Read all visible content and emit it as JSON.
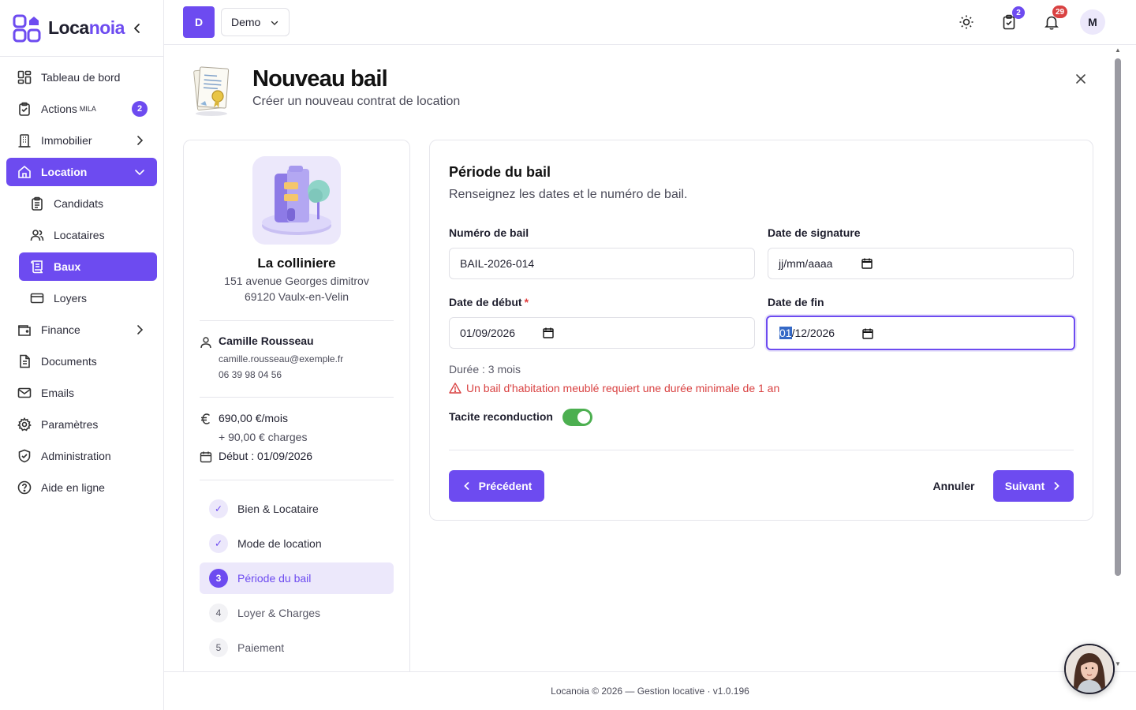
{
  "brand": {
    "name_a": "Loca",
    "name_b": "noia"
  },
  "sidebar": {
    "items": [
      {
        "label": "Tableau de bord"
      },
      {
        "label": "Actions",
        "sup": "MILA",
        "badge": "2"
      },
      {
        "label": "Immobilier"
      },
      {
        "label": "Location"
      },
      {
        "label": "Candidats"
      },
      {
        "label": "Locataires"
      },
      {
        "label": "Baux"
      },
      {
        "label": "Loyers"
      },
      {
        "label": "Finance"
      },
      {
        "label": "Documents"
      },
      {
        "label": "Emails"
      },
      {
        "label": "Paramètres"
      },
      {
        "label": "Administration"
      },
      {
        "label": "Aide en ligne"
      }
    ]
  },
  "topbar": {
    "org_initial": "D",
    "org_name": "Demo",
    "tasks_badge": "2",
    "notif_badge": "29",
    "user_initial": "M"
  },
  "page": {
    "title": "Nouveau bail",
    "subtitle": "Créer un nouveau contrat de location"
  },
  "summary": {
    "property_name": "La colliniere",
    "address_line1": "151 avenue Georges dimitrov",
    "address_line2": "69120 Vaulx-en-Velin",
    "tenant_name": "Camille Rousseau",
    "tenant_email": "camille.rousseau@exemple.fr",
    "tenant_phone": "06 39 98 04 56",
    "rent": "690,00 €/mois",
    "charges": "+ 90,00 € charges",
    "start": "Début : 01/09/2026",
    "steps": [
      {
        "num": "✓",
        "label": "Bien & Locataire",
        "state": "done"
      },
      {
        "num": "✓",
        "label": "Mode de location",
        "state": "done"
      },
      {
        "num": "3",
        "label": "Période du bail",
        "state": "current"
      },
      {
        "num": "4",
        "label": "Loyer & Charges",
        "state": "todo"
      },
      {
        "num": "5",
        "label": "Paiement",
        "state": "todo"
      }
    ]
  },
  "form": {
    "title": "Période du bail",
    "subtitle": "Renseignez les dates et le numéro de bail.",
    "lease_number_label": "Numéro de bail",
    "lease_number_value": "BAIL-2026-014",
    "signature_label": "Date de signature",
    "signature_value": "jj/mm/aaaa",
    "start_label": "Date de début",
    "start_required": "*",
    "start_value": "01/09/2026",
    "end_label": "Date de fin",
    "end_value_selected": "01",
    "end_value_rest": "/12/2026",
    "duration": "Durée : 3 mois",
    "warning": "Un bail d'habitation meublé requiert une durée minimale de 1 an",
    "tacit_label": "Tacite reconduction",
    "tacit_on": true,
    "prev_button": "Précédent",
    "cancel_button": "Annuler",
    "next_button": "Suivant"
  },
  "footer": {
    "text": "Locanoia © 2026 — Gestion locative · v1.0.196"
  },
  "colors": {
    "accent": "#6d4bf0",
    "accent_soft": "#ece8fb",
    "success": "#4caf50",
    "danger": "#d94242",
    "notif": "#d94242"
  }
}
